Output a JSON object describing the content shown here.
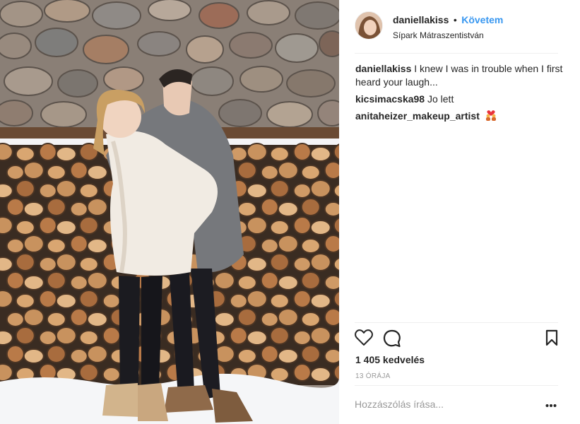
{
  "post": {
    "image_alt": "Couple hugging in front of a stack of firewood and a stone wall in the snow"
  },
  "header": {
    "username": "daniellakiss",
    "separator": "•",
    "follow_label": "Követem",
    "location": "Sípark Mátraszentistván",
    "follow_color": "#3897f0"
  },
  "comments": [
    {
      "user": "daniellakiss",
      "text": "I knew I was in trouble when I first heard your laugh..."
    },
    {
      "user": "kicsimacska98",
      "text": "Jo lett"
    },
    {
      "user": "anitaheizer_makeup_artist",
      "text": "",
      "emoji": "couple-heart-emoji"
    }
  ],
  "actions": {
    "like_icon": "heart-icon",
    "comment_icon": "speech-bubble-icon",
    "save_icon": "bookmark-icon"
  },
  "likes_text": "1 405 kedvelés",
  "time_text": "13 ÓRÁJA",
  "comment_box": {
    "placeholder": "Hozzászólás írása..."
  },
  "more_icon": "ellipsis-icon"
}
